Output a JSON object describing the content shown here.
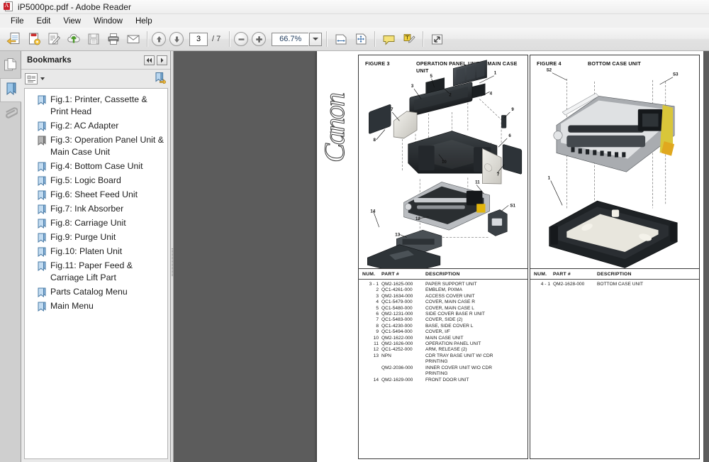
{
  "window": {
    "title": "iP5000pc.pdf - Adobe Reader",
    "app_icon": "pdf-document-icon"
  },
  "menubar": {
    "items": [
      {
        "label": "File"
      },
      {
        "label": "Edit"
      },
      {
        "label": "View"
      },
      {
        "label": "Window"
      },
      {
        "label": "Help"
      }
    ]
  },
  "toolbar": {
    "buttons": [
      {
        "name": "open-file-icon",
        "title": "Open"
      },
      {
        "name": "create-pdf-icon",
        "title": "Create PDF"
      },
      {
        "name": "sign-icon",
        "title": "Sign"
      },
      {
        "name": "upload-cloud-icon",
        "title": "Upload"
      },
      {
        "name": "save-icon",
        "title": "Save"
      },
      {
        "name": "print-icon",
        "title": "Print"
      },
      {
        "name": "email-icon",
        "title": "Email"
      }
    ],
    "prev_page_icon": "arrow-up-icon",
    "next_page_icon": "arrow-down-icon",
    "page_current": "3",
    "page_total": "/ 7",
    "zoom_out_icon": "minus-icon",
    "zoom_in_icon": "plus-icon",
    "zoom_value": "66.7%",
    "zoom_dropdown_icon": "chevron-down-icon",
    "right_buttons": [
      {
        "name": "fit-width-icon",
        "title": "Fit Width"
      },
      {
        "name": "fit-page-icon",
        "title": "Fit Page"
      },
      {
        "name": "comment-icon",
        "title": "Add Comment"
      },
      {
        "name": "highlight-icon",
        "title": "Highlight Text"
      },
      {
        "name": "full-screen-icon",
        "title": "Read Mode"
      }
    ]
  },
  "sidebar": {
    "rail_tabs": [
      {
        "name": "page-thumbnails-tab",
        "icon": "pages-icon",
        "active": false
      },
      {
        "name": "bookmarks-tab",
        "icon": "bookmark-icon",
        "active": true
      },
      {
        "name": "attachments-tab",
        "icon": "paperclip-icon",
        "active": false
      }
    ],
    "header": {
      "title": "Bookmarks",
      "collapse_icon": "double-arrow-left-icon",
      "expand_icon": "arrow-right-icon"
    },
    "tools": {
      "options_icon": "options-list-icon",
      "options_caret": "caret-down-icon",
      "new_bookmark_icon": "new-bookmark-icon"
    },
    "bookmarks": [
      {
        "label": "Fig.1: Printer, Cassette & Print Head",
        "selected": false
      },
      {
        "label": "Fig.2: AC Adapter",
        "selected": false
      },
      {
        "label": "Fig.3: Operation Panel Unit & Main Case Unit",
        "selected": true
      },
      {
        "label": "Fig.4: Bottom Case Unit",
        "selected": false
      },
      {
        "label": "Fig.5: Logic Board",
        "selected": false
      },
      {
        "label": "Fig.6: Sheet Feed Unit",
        "selected": false
      },
      {
        "label": "Fig.7: Ink Absorber",
        "selected": false
      },
      {
        "label": "Fig.8: Carriage Unit",
        "selected": false
      },
      {
        "label": "Fig.9: Purge Unit",
        "selected": false
      },
      {
        "label": "Fig.10: Platen Unit",
        "selected": false
      },
      {
        "label": "Fig.11: Paper Feed & Carriage Lift Part",
        "selected": false
      },
      {
        "label": "Parts Catalog Menu",
        "selected": false
      },
      {
        "label": "Main Menu",
        "selected": false
      }
    ]
  },
  "document": {
    "brand_logo_text": "Canon",
    "figures": [
      {
        "number": "FIGURE 3",
        "title": "OPERATION PANEL UNIT & MAIN CASE UNIT",
        "callouts": [
          "1",
          "2",
          "3",
          "4",
          "5",
          "6",
          "7",
          "8",
          "9",
          "10",
          "11",
          "12",
          "13",
          "14",
          "S1"
        ],
        "table": {
          "headers": {
            "num": "NUM.",
            "part": "PART #",
            "desc": "DESCRIPTION"
          },
          "rows": [
            {
              "num": "3 - 1",
              "part": "QM2-1625-000",
              "desc": "PAPER SUPPORT UNIT"
            },
            {
              "num": "2",
              "part": "QC1-4261-000",
              "desc": "EMBLEM, PIXMA"
            },
            {
              "num": "3",
              "part": "QM2-1634-000",
              "desc": "ACCESS COVER UNIT"
            },
            {
              "num": "4",
              "part": "QC1-5479-000",
              "desc": "COVER, MAIN CASE R"
            },
            {
              "num": "5",
              "part": "QC1-5480-000",
              "desc": "COVER, MAIN CASE L"
            },
            {
              "num": "6",
              "part": "QM2-1231-000",
              "desc": "SIDE COVER BASE R UNIT"
            },
            {
              "num": "7",
              "part": "QC1-5483-000",
              "desc": "COVER, SIDE (2)"
            },
            {
              "num": "8",
              "part": "QC1-4230-000",
              "desc": "BASE, SIDE COVER L"
            },
            {
              "num": "9",
              "part": "QC1-5494-000",
              "desc": "COVER, I/F"
            },
            {
              "num": "10",
              "part": "QM2-1622-000",
              "desc": "MAIN CASE UNIT"
            },
            {
              "num": "11",
              "part": "QM2-1626-000",
              "desc": "OPERATION PANEL UNIT"
            },
            {
              "num": "12",
              "part": "QC1-4252-000",
              "desc": "ARM, RELEASE (2)"
            },
            {
              "num": "13",
              "part": "NPN",
              "desc": "CDR TRAY BASE UNIT W/ CDR"
            },
            {
              "num": "",
              "part": "",
              "desc": "PRINTING"
            },
            {
              "num": "",
              "part": "QM2-2036-000",
              "desc": "INNER COVER UNIT W/O CDR"
            },
            {
              "num": "",
              "part": "",
              "desc": "PRINTING"
            },
            {
              "num": "14",
              "part": "QM2-1629-000",
              "desc": "FRONT DOOR UNIT"
            }
          ]
        }
      },
      {
        "number": "FIGURE 4",
        "title": "BOTTOM CASE UNIT",
        "callouts": [
          "1",
          "S2",
          "S3"
        ],
        "table": {
          "headers": {
            "num": "NUM.",
            "part": "PART #",
            "desc": "DESCRIPTION"
          },
          "rows": [
            {
              "num": "4 - 1",
              "part": "QM2-1628-000",
              "desc": "BOTTOM CASE UNIT"
            }
          ]
        }
      }
    ]
  },
  "colors": {
    "doc_background": "#5c5c5c",
    "chrome": "#f0f0f0",
    "panel": "#e9e9e9",
    "accent_red": "#c8202a",
    "zoom_text": "#1e3a5c"
  }
}
